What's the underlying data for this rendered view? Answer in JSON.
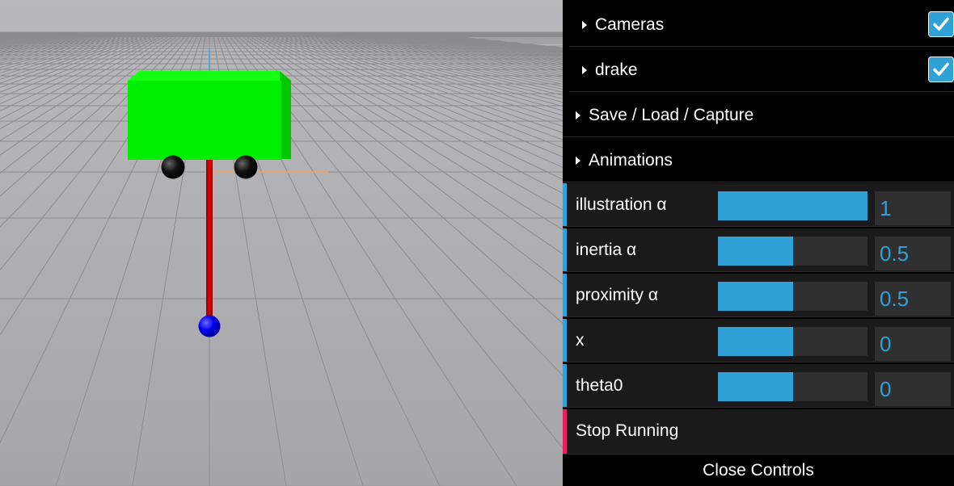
{
  "controls": {
    "folders": {
      "cameras": {
        "label": "Cameras",
        "checked": true
      },
      "drake": {
        "label": "drake",
        "checked": true
      },
      "save_load": {
        "label": "Save / Load / Capture"
      },
      "animations": {
        "label": "Animations"
      }
    },
    "sliders": [
      {
        "label": "illustration α",
        "value": "1",
        "fraction": 1.0
      },
      {
        "label": "inertia α",
        "value": "0.5",
        "fraction": 0.5
      },
      {
        "label": "proximity α",
        "value": "0.5",
        "fraction": 0.5
      },
      {
        "label": "x",
        "value": "0",
        "fraction": 0.5
      },
      {
        "label": "theta0",
        "value": "0",
        "fraction": 0.5
      }
    ],
    "stop_label": "Stop Running",
    "close_label": "Close Controls"
  },
  "scene": {
    "background_top": "#b8b8bb",
    "background_bottom": "#a4a4a6",
    "cart_color": "#00e600",
    "wheel_color": "#000000",
    "pole_color": "#cc0000",
    "mass_color": "#0000ff",
    "accent_color": "#2fa1d6",
    "stop_accent_color": "#e61d5f"
  }
}
